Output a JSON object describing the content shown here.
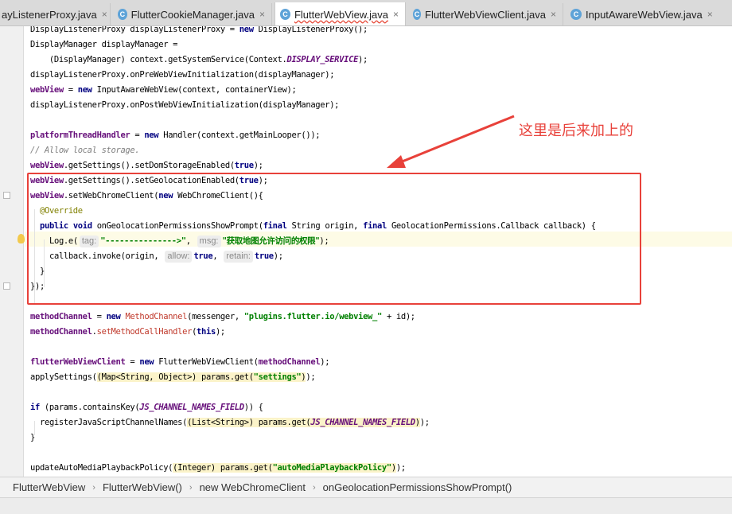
{
  "tabs": [
    {
      "label": "ayListenerProxy.java",
      "icon": "",
      "active": false
    },
    {
      "label": "FlutterCookieManager.java",
      "icon": "C",
      "active": false
    },
    {
      "label": "FlutterWebView.java",
      "icon": "C",
      "active": true
    },
    {
      "label": "FlutterWebViewClient.java",
      "icon": "C",
      "active": false
    },
    {
      "label": "InputAwareWebView.java",
      "icon": "C",
      "active": false
    }
  ],
  "tab_close_glyph": "×",
  "code": {
    "l1": {
      "a": "DisplayListenerProxy displayListenerProxy = ",
      "b": "new",
      "c": " DisplayListenerProxy();"
    },
    "l2": "DisplayManager displayManager =",
    "l3": {
      "a": "    (DisplayManager) context.getSystemService(Context.",
      "b": "DISPLAY_SERVICE",
      "c": ");"
    },
    "l4": "displayListenerProxy.onPreWebViewInitialization(displayManager);",
    "l5": {
      "a": "webView",
      "b": " = ",
      "c": "new",
      "d": " InputAwareWebView(context, containerView);"
    },
    "l6": "displayListenerProxy.onPostWebViewInitialization(displayManager);",
    "l8": {
      "a": "platformThreadHandler",
      "b": " = ",
      "c": "new",
      "d": " Handler(context.getMainLooper());"
    },
    "l9": "// Allow local storage.",
    "l10": {
      "a": "webView",
      "b": ".getSettings().setDomStorageEnabled(",
      "c": "true",
      "d": ");"
    },
    "l11": {
      "a": "webView",
      "b": ".getSettings().setGeolocationEnabled(",
      "c": "true",
      "d": ");"
    },
    "l12": {
      "a": "webView",
      "b": ".setWebChromeClient(",
      "c": "new",
      "d": " WebChromeClient(){"
    },
    "l13": "@Override",
    "l14": {
      "a": "public",
      "b": " ",
      "c": "void",
      "d": " onGeolocationPermissionsShowPrompt(",
      "e": "final",
      "f": " String origin, ",
      "g": "final",
      "h": " GeolocationPermissions.Callback callback) {"
    },
    "l15": {
      "a": "Log.e(",
      "hint1": "tag:",
      "s1": "\"--------------->\"",
      "b": ", ",
      "hint2": "msg:",
      "s2": "\"获取地图允许访问的权限\"",
      "c": ");"
    },
    "l16": {
      "a": "callback.invoke(origin, ",
      "hint1": "allow:",
      "b": "true",
      "c": ", ",
      "hint2": "retain:",
      "d": "true",
      "e": ");"
    },
    "l17": "}",
    "l18": "});",
    "l20": {
      "a": "methodChannel",
      "b": " = ",
      "c": "new",
      "d": " ",
      "e": "MethodChannel",
      "f": "(messenger, ",
      "g": "\"plugins.flutter.io/webview_\"",
      "h": " + id);"
    },
    "l21": {
      "a": "methodChannel",
      "b": ".",
      "c": "setMethodCallHandler",
      "d": "(",
      "e": "this",
      "f": ");"
    },
    "l23": {
      "a": "flutterWebViewClient",
      "b": " = ",
      "c": "new",
      "d": " FlutterWebViewClient(",
      "e": "methodChannel",
      "f": ");"
    },
    "l24": {
      "a": "applySettings(",
      "b": "(Map<String, Object>) params.get(",
      "c": "\"settings\"",
      "d": ")",
      "e": ");"
    },
    "l26": {
      "a": "if",
      "b": " (params.containsKey(",
      "c": "JS_CHANNEL_NAMES_FIELD",
      "d": ")) {"
    },
    "l27": {
      "a": "registerJavaScriptChannelNames(",
      "b": "(List<String>) params.get(",
      "c": "JS_CHANNEL_NAMES_FIELD",
      "d": ")",
      "e": ");"
    },
    "l28": "}",
    "l30": {
      "a": "updateAutoMediaPlaybackPolicy(",
      "b": "(Integer) params.get(",
      "c": "\"autoMediaPlaybackPolicy\"",
      "d": ")",
      "e": ");"
    }
  },
  "annotation": {
    "text": "这里是后来加上的",
    "color": "#e8413a"
  },
  "breadcrumb": [
    "FlutterWebView",
    "FlutterWebView()",
    "new WebChromeClient",
    "onGeolocationPermissionsShowPrompt()"
  ],
  "breadcrumb_separator": "›",
  "icons": [
    "class-c-icon",
    "close-icon",
    "fold-marker-icon",
    "intention-bulb-icon",
    "breadcrumb-separator-icon"
  ],
  "colors": {
    "keyword": "#000080",
    "field": "#660e7a",
    "string": "#008000",
    "comment": "#808080",
    "annotation": "#808000",
    "callout": "#e8413a"
  }
}
